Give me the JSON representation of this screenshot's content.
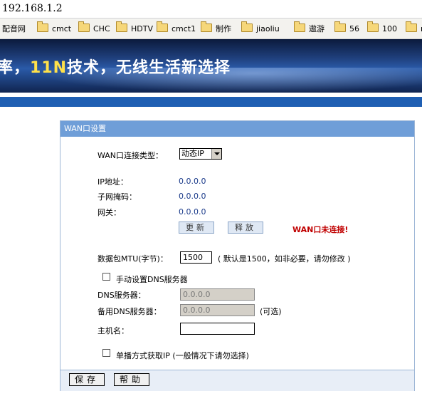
{
  "address_bar": {
    "url": "192.168.1.2"
  },
  "bookmarks": [
    {
      "label": "配音网",
      "folder": false
    },
    {
      "label": "cmct",
      "folder": true
    },
    {
      "label": "CHC",
      "folder": true
    },
    {
      "label": "HDTV",
      "folder": true
    },
    {
      "label": "cmct1",
      "folder": true
    },
    {
      "label": "制作",
      "folder": true
    },
    {
      "label": "jiaoliu",
      "folder": true
    },
    {
      "label": "遨游",
      "folder": true
    },
    {
      "label": "56",
      "folder": true
    },
    {
      "label": "100",
      "folder": true
    },
    {
      "label": "m",
      "folder": true
    }
  ],
  "banner": {
    "slogan_pre": "率，",
    "slogan_hl": "11N",
    "slogan_post": "技术，无线生活新选择"
  },
  "panel": {
    "title": "WAN口设置",
    "wan_type_label": "WAN口连接类型：",
    "wan_type_value": "动态IP",
    "ip_label": "IP地址：",
    "ip_value": "0.0.0.0",
    "mask_label": "子网掩码：",
    "mask_value": "0.0.0.0",
    "gw_label": "网关：",
    "gw_value": "0.0.0.0",
    "refresh_btn": "更新",
    "release_btn": "释放",
    "status_text": "WAN口未连接!",
    "mtu_label": "数据包MTU(字节)：",
    "mtu_value": "1500",
    "mtu_hint": "( 默认是1500，如非必要，请勿修改 )",
    "manual_dns_label": "手动设置DNS服务器",
    "dns_label": "DNS服务器：",
    "dns_value": "0.0.0.0",
    "dns2_label": "备用DNS服务器：",
    "dns2_value": "0.0.0.0",
    "dns2_hint": "(可选)",
    "host_label": "主机名：",
    "host_value": "",
    "unicast_label": "单播方式获取IP (一般情况下请勿选择)",
    "save_btn": "保存",
    "help_btn": "帮助"
  }
}
